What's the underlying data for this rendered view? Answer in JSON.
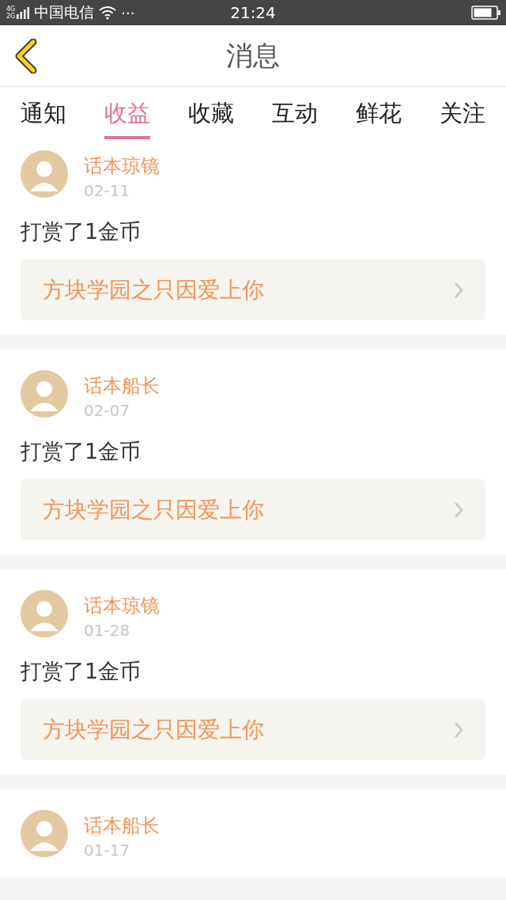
{
  "status_bar": {
    "network_top": "4G",
    "network_bottom": "2G",
    "carrier": "中国电信",
    "more": "···",
    "time": "21:24"
  },
  "header": {
    "title": "消息"
  },
  "tabs": [
    {
      "label": "通知",
      "selected": false
    },
    {
      "label": "收益",
      "selected": true
    },
    {
      "label": "收藏",
      "selected": false
    },
    {
      "label": "互动",
      "selected": false
    },
    {
      "label": "鲜花",
      "selected": false
    },
    {
      "label": "关注",
      "selected": false
    }
  ],
  "messages": [
    {
      "sender": "话本琼镜",
      "date": "02-11",
      "text": "打赏了1金币",
      "work": "方块学园之只因爱上你"
    },
    {
      "sender": "话本船长",
      "date": "02-07",
      "text": "打赏了1金币",
      "work": "方块学园之只因爱上你"
    },
    {
      "sender": "话本琼镜",
      "date": "01-28",
      "text": "打赏了1金币",
      "work": "方块学园之只因爱上你"
    },
    {
      "sender": "话本船长",
      "date": "01-17"
    }
  ]
}
